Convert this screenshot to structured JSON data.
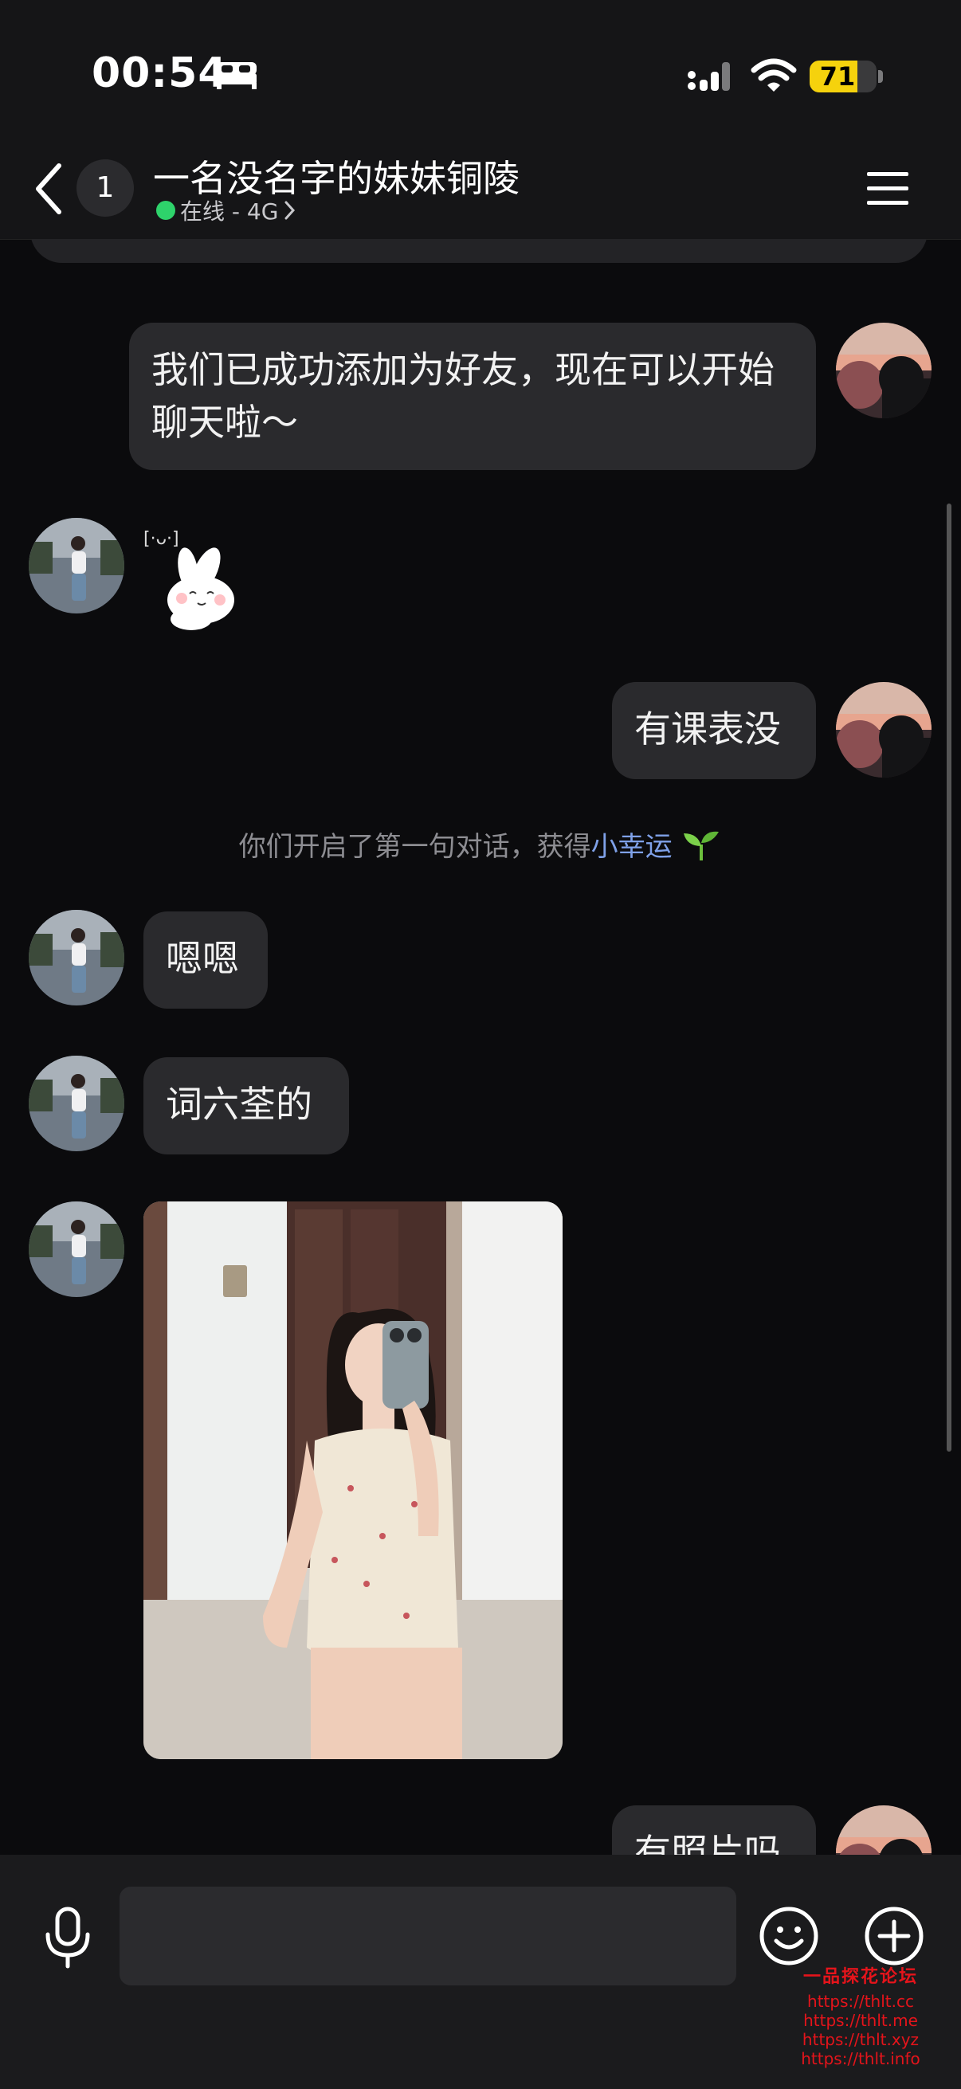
{
  "status_bar": {
    "time": "00:54",
    "battery_level": "71",
    "battery_fraction": 0.71,
    "icons": [
      "bed-icon",
      "signal-icon",
      "wifi-icon",
      "battery-icon"
    ]
  },
  "header": {
    "unread_count": "1",
    "title": "一名没名字的妹妹铜陵",
    "status": "在线 - 4G",
    "icons": [
      "back-icon",
      "menu-icon",
      "chevron-right-icon"
    ]
  },
  "messages": {
    "m1": "我们已成功添加为好友，现在可以开始聊天啦～",
    "m2_sticker": "rabbit-sticker",
    "m3": "有课表没",
    "system_prefix": "你们开启了第一句对话，获得",
    "system_link": "小幸运",
    "system_icon": "sprout-icon",
    "m4": "嗯嗯",
    "m5": "词六荃的",
    "m6_photo": "selfie-photo",
    "m7": "有照片吗"
  },
  "input_bar": {
    "placeholder": "",
    "icons": [
      "mic-icon",
      "emoji-icon",
      "plus-icon"
    ]
  },
  "watermark": {
    "title": "一品探花论坛",
    "lines": [
      "https://thlt.cc",
      "https://thlt.me",
      "https://thlt.xyz",
      "https://thlt.info"
    ]
  },
  "colors": {
    "background": "#0b0b0d",
    "bubble": "#2a2a2d",
    "online": "#2ed36b",
    "battery": "#f5d20d",
    "link": "#7fa1e8",
    "watermark": "#e5141b"
  }
}
